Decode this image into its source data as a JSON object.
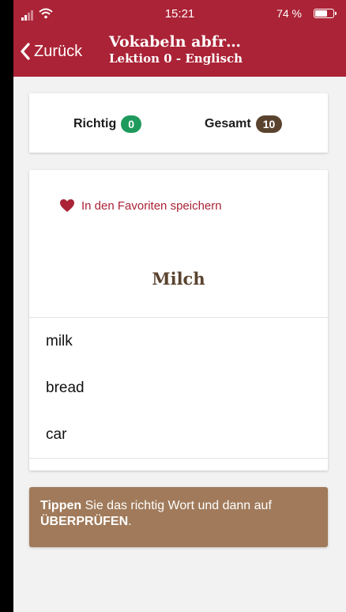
{
  "status_bar": {
    "time": "15:21",
    "battery_text": "74 %",
    "battery_level": 0.74
  },
  "nav": {
    "back_label": "Zurück",
    "title": "Vokabeln abfr…",
    "subtitle": "Lektion 0 - Englisch"
  },
  "score": {
    "correct_label": "Richtig",
    "correct_value": "0",
    "total_label": "Gesamt",
    "total_value": "10"
  },
  "quiz": {
    "favorite_label": "In den Favoriten speichern",
    "word": "Milch",
    "options": [
      "milk",
      "bread",
      "car"
    ]
  },
  "hint": {
    "part1_bold": "Tippen",
    "part2": " Sie das richtig Wort und dann auf ",
    "part3_bold": "ÜBERPRÜFEN",
    "part4": "."
  },
  "colors": {
    "header": "#ab2336",
    "correct_badge": "#1e9a5c",
    "total_badge": "#5a432e",
    "hint_bg": "#a07a5a"
  }
}
